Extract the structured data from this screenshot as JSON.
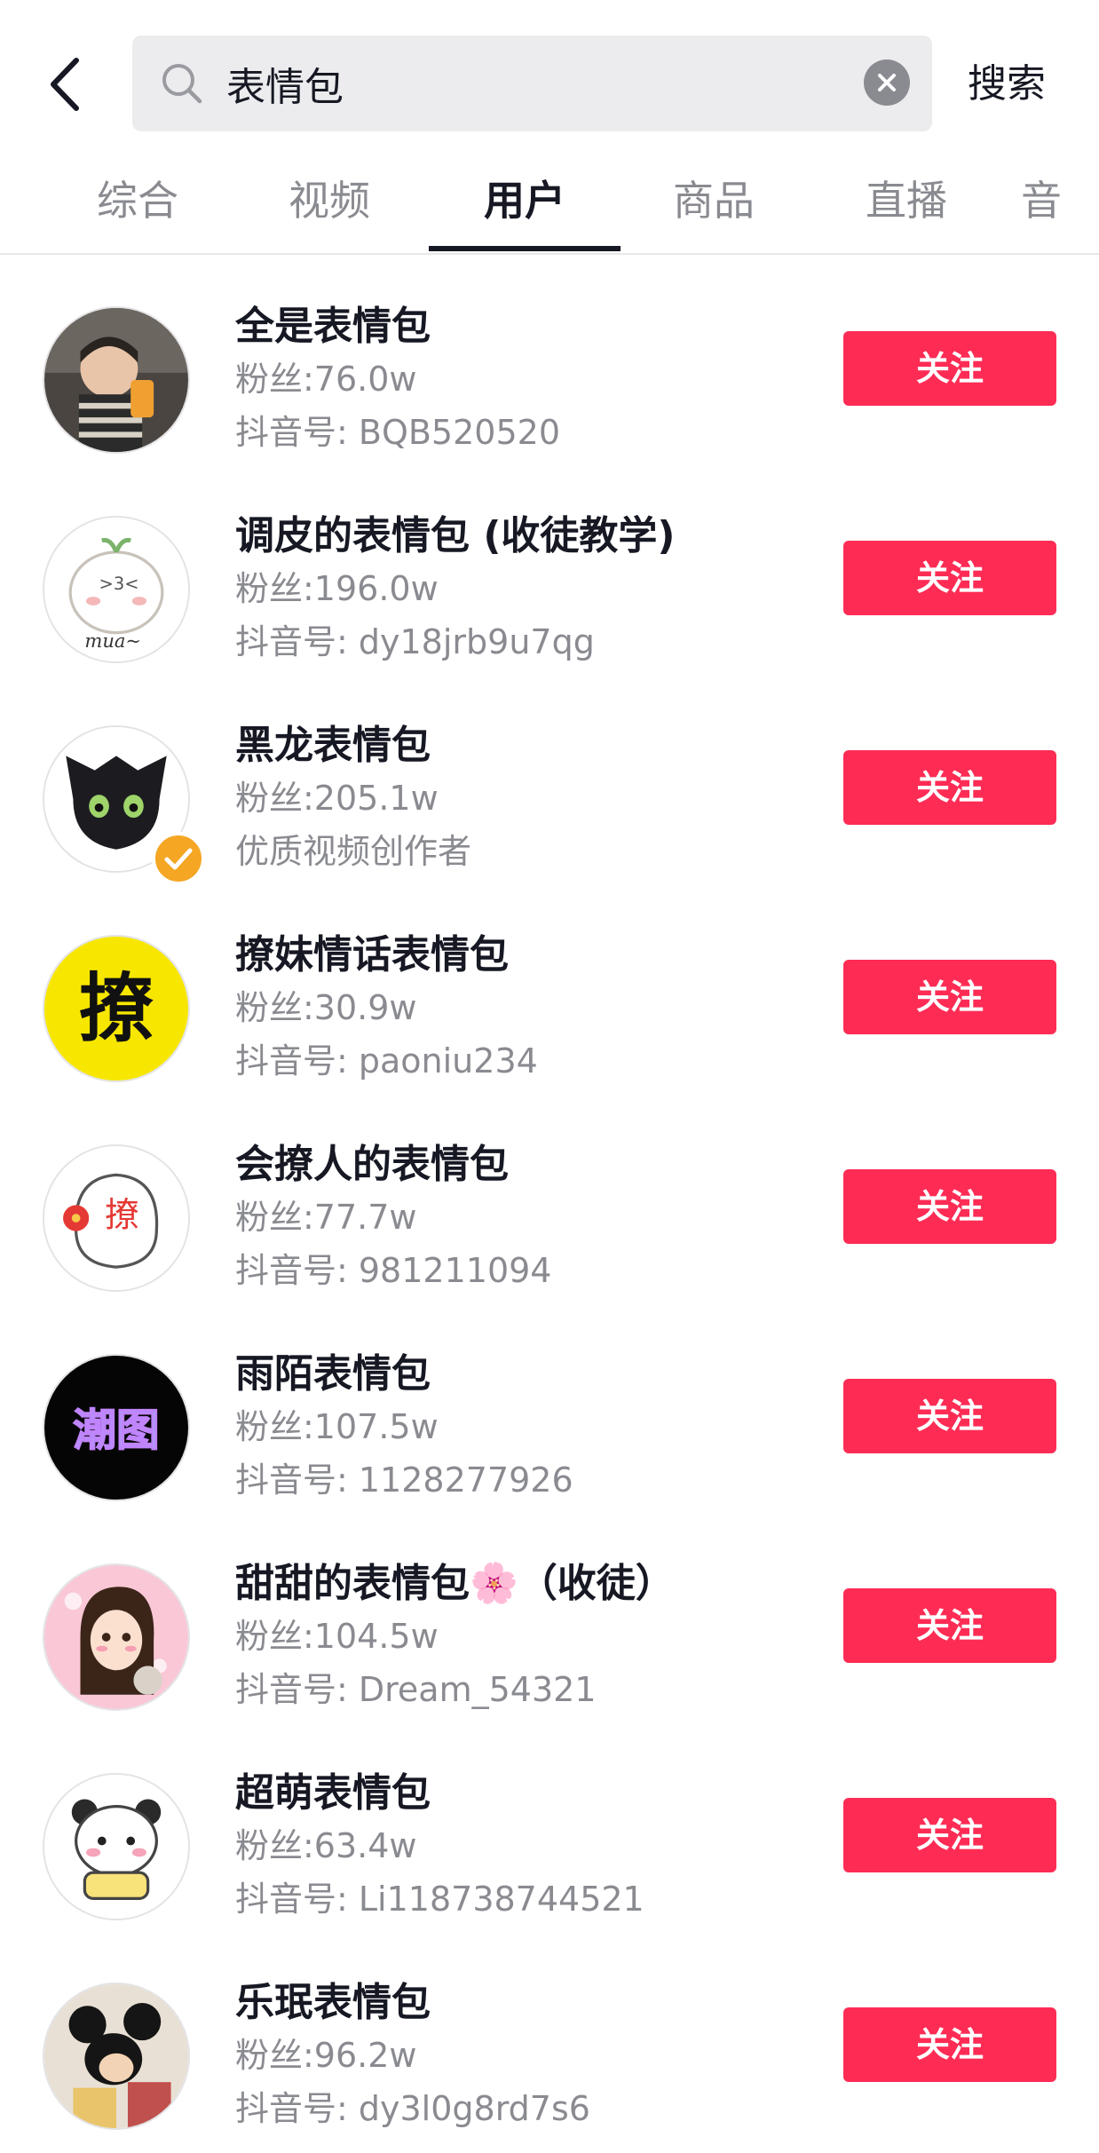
{
  "search": {
    "query": "表情包",
    "button_label": "搜索"
  },
  "tabs": [
    {
      "label": "综合",
      "active": false
    },
    {
      "label": "视频",
      "active": false
    },
    {
      "label": "用户",
      "active": true
    },
    {
      "label": "商品",
      "active": false
    },
    {
      "label": "直播",
      "active": false
    },
    {
      "label": "音",
      "active": false
    }
  ],
  "results": [
    {
      "name": "全是表情包",
      "fans": "粉丝:76.0w",
      "sub": "抖音号: BQB520520",
      "follow_label": "关注",
      "avatar": "toddler-photo"
    },
    {
      "name": "调皮的表情包 (收徒教学)",
      "fans": "粉丝:196.0w",
      "sub": "抖音号: dy18jrb9u7qg",
      "follow_label": "关注",
      "avatar": "cartoon-bun"
    },
    {
      "name": "黑龙表情包",
      "fans": "粉丝:205.1w",
      "sub": "优质视频创作者",
      "follow_label": "关注",
      "avatar": "black-dragon",
      "verified": true
    },
    {
      "name": "撩妹情话表情包",
      "fans": "粉丝:30.9w",
      "sub": "抖音号: paoniu234",
      "follow_label": "关注",
      "avatar": "yellow-liao",
      "avatar_text": "撩"
    },
    {
      "name": "会撩人的表情包",
      "fans": "粉丝:77.7w",
      "sub": "抖音号: 981211094",
      "follow_label": "关注",
      "avatar": "white-liao",
      "avatar_text": "撩"
    },
    {
      "name": "雨陌表情包",
      "fans": "粉丝:107.5w",
      "sub": "抖音号: 1128277926",
      "follow_label": "关注",
      "avatar": "chaotu",
      "avatar_text": "潮图"
    },
    {
      "name": "甜甜的表情包🌸（收徒）",
      "fans": "粉丝:104.5w",
      "sub": "抖音号: Dream_54321",
      "follow_label": "关注",
      "avatar": "anime-girl"
    },
    {
      "name": "超萌表情包",
      "fans": "粉丝:63.4w",
      "sub": "抖音号: Li118738744521",
      "follow_label": "关注",
      "avatar": "panda"
    },
    {
      "name": "乐珉表情包",
      "fans": "粉丝:96.2w",
      "sub": "抖音号: dy3l0g8rd7s6",
      "follow_label": "关注",
      "avatar": "mickey"
    }
  ],
  "colors": {
    "accent": "#fe2c55",
    "text": "#161823",
    "muted": "#8a8b91",
    "search_bg": "#ececee",
    "verified": "#f5a623"
  },
  "icons": {
    "back": "chevron-left-icon",
    "search": "search-icon",
    "clear": "clear-icon",
    "verified": "verified-badge-icon"
  }
}
